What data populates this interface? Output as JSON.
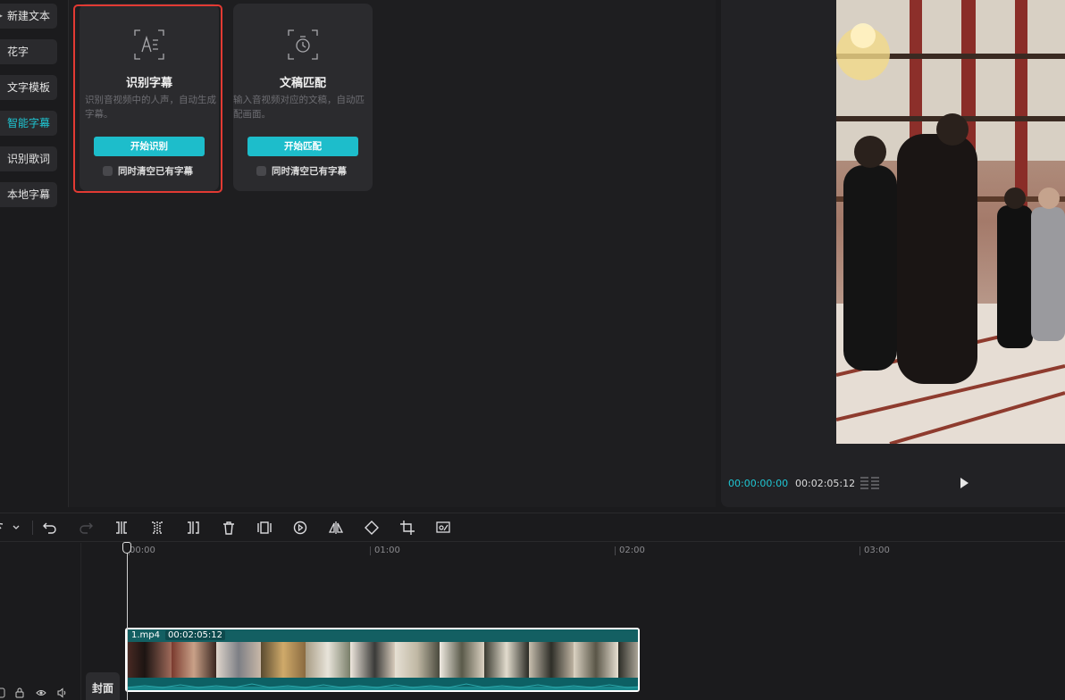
{
  "sidebar": {
    "items": [
      {
        "label": "新建文本",
        "active": false
      },
      {
        "label": "花字",
        "active": false
      },
      {
        "label": "文字模板",
        "active": false
      },
      {
        "label": "智能字幕",
        "active": true
      },
      {
        "label": "识别歌词",
        "active": false
      },
      {
        "label": "本地字幕",
        "active": false
      }
    ]
  },
  "cards": [
    {
      "title": "识别字幕",
      "description": "识别音视频中的人声，自动生成字幕。",
      "button": "开始识别",
      "checkbox_label": "同时清空已有字幕",
      "checked": false,
      "icon": "subtitle-recognize-icon"
    },
    {
      "title": "文稿匹配",
      "description": "输入音视频对应的文稿，自动匹配画面。",
      "button": "开始匹配",
      "checkbox_label": "同时清空已有字幕",
      "checked": false,
      "icon": "script-match-icon"
    }
  ],
  "preview": {
    "current_time": "00:00:00:00",
    "total_time": "00:02:05:12"
  },
  "timeline": {
    "ruler_labels": [
      "00:00",
      "01:00",
      "02:00",
      "03:00"
    ],
    "cover_label": "封面",
    "clip": {
      "filename": "1.mp4",
      "duration": "00:02:05:12"
    }
  },
  "colors": {
    "accent": "#1dbdcb",
    "highlight": "#e23a33",
    "clip": "#0b6a6e"
  }
}
